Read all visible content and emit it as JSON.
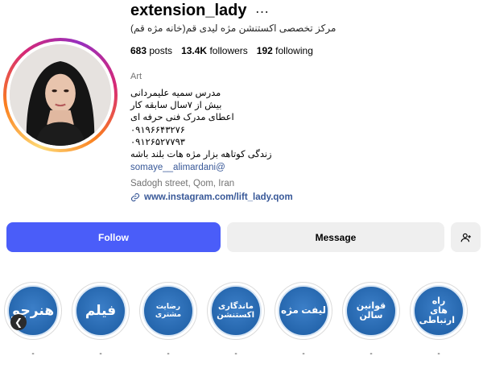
{
  "profile": {
    "username": "extension_lady",
    "more_icon": "…",
    "bio_title": "مرکز تخصصی اکستنشن مژه لیدی قم(خانه مژه قم)",
    "avatar_icon": "profile-photo"
  },
  "stats": [
    {
      "count": "683",
      "label": "posts"
    },
    {
      "count": "13.4K",
      "label": "followers"
    },
    {
      "count": "192",
      "label": "following"
    }
  ],
  "category": "Art",
  "bio_lines": [
    "مدرس سمیه علیمردانی",
    "بیش از ۷سال سابقه کار",
    "اعطای مدرک فنی حرفه ای",
    "۰۹۱۹۶۶۴۳۲۷۶",
    "۰۹۱۲۶۵۲۷۷۹۳",
    "زندگی کوتاهه بزار مژه هات بلند باشه"
  ],
  "mention": "somaye__alimardani@",
  "address": "Sadogh street, Qom, Iran",
  "link": "www.instagram.com/lift_lady.qom",
  "buttons": {
    "follow": "Follow",
    "message": "Message",
    "add_user_icon": "add-user-icon"
  },
  "highlights": [
    {
      "title": "هنرجو",
      "label": "-"
    },
    {
      "title": "فیلم",
      "label": "-"
    },
    {
      "title": "رضایت مشتری",
      "label": "-"
    },
    {
      "title": "ماندگاری اکستنشن",
      "label": "-"
    },
    {
      "title": "لیفت مژه",
      "label": "-"
    },
    {
      "title": "قوانین سالن",
      "label": "-"
    },
    {
      "title": "راه های ارتباطی",
      "label": "-"
    }
  ],
  "colors": {
    "follow_bg": "#4a5df9",
    "highlight_blue": "#2566ad",
    "link": "#385898"
  }
}
